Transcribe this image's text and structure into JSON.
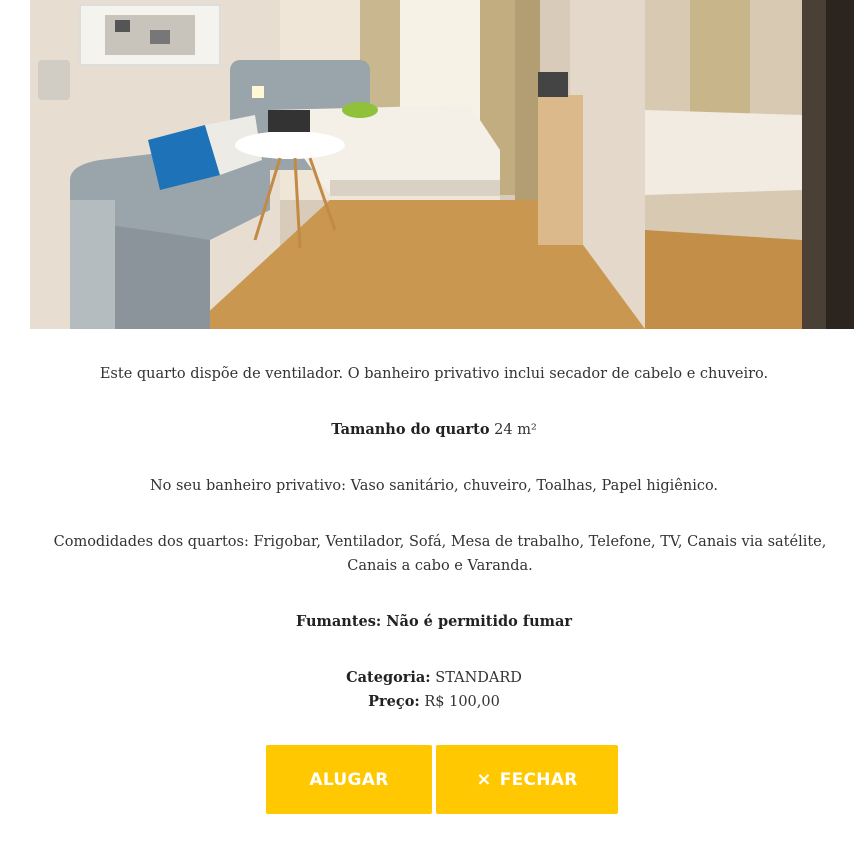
{
  "room": {
    "description": "Este quarto dispõe de ventilador. O banheiro privativo inclui secador de cabelo e chuveiro.",
    "size_label": "Tamanho do quarto",
    "size_value": "24 m²",
    "bathroom_text": "No seu banheiro privativo: Vaso sanitário, chuveiro, Toalhas, Papel higiênico.",
    "amenities_text": "Comodidades dos quartos: Frigobar, Ventilador, Sofá, Mesa de trabalho, Telefone, TV, Canais via satélite, Canais a cabo e Varanda.",
    "smoking_text": "Fumantes: Não é permitido fumar",
    "category_label": "Categoria:",
    "category_value": "STANDARD",
    "price_label": "Preço:",
    "price_value": "R$ 100,00"
  },
  "actions": {
    "rent_label": "ALUGAR",
    "close_icon": "×",
    "close_label": "FECHAR"
  },
  "colors": {
    "button_bg": "#ffc800",
    "button_text": "#ffffff"
  }
}
